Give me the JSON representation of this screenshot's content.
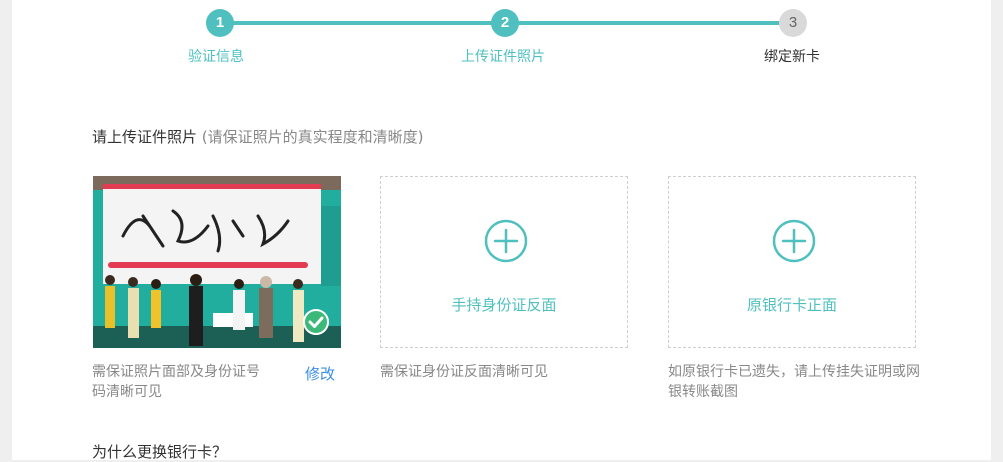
{
  "stepper": {
    "steps": [
      {
        "num": "1",
        "label": "验证信息"
      },
      {
        "num": "2",
        "label": "上传证件照片"
      },
      {
        "num": "3",
        "label": "绑定新卡"
      }
    ]
  },
  "section": {
    "title": "请上传证件照片",
    "hint": " (请保证照片的真实程度和清晰度)"
  },
  "uploads": [
    {
      "desc": "需保证照片面部及身份证号码清晰可见",
      "action": "修改"
    },
    {
      "label": "手持身份证反面",
      "desc": "需保证身份证反面清晰可见"
    },
    {
      "label": "原银行卡正面",
      "desc": "如原银行卡已遗失，请上传挂失证明或网银转账截图"
    }
  ],
  "footer": {
    "question": "为什么更换银行卡？"
  },
  "colors": {
    "accent": "#4fc0bf",
    "link": "#3a8ee6",
    "inactive": "#d9d9d9"
  }
}
